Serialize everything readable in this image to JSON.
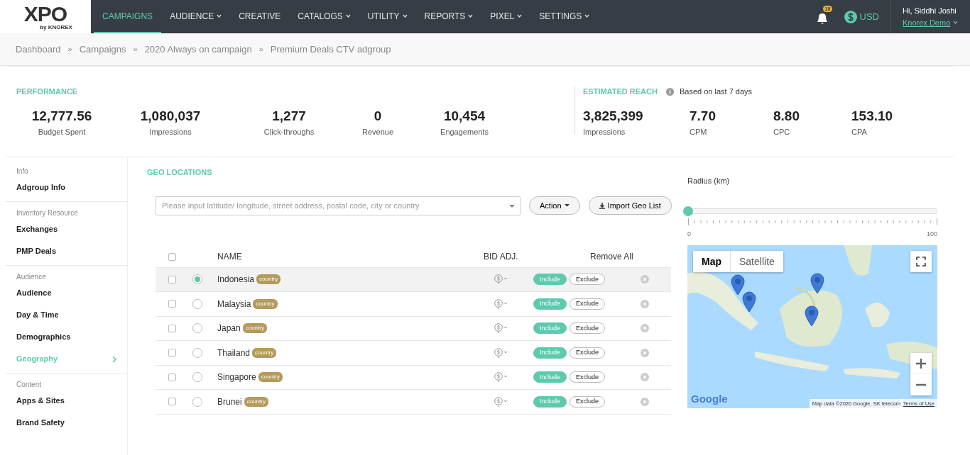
{
  "navbar": {
    "logo": "XPO",
    "logo_sub": "by KNOREX",
    "items": [
      {
        "label": "CAMPAIGNS",
        "dropdown": false,
        "selected": true
      },
      {
        "label": "AUDIENCE",
        "dropdown": true,
        "selected": false
      },
      {
        "label": "CREATIVE",
        "dropdown": false,
        "selected": false
      },
      {
        "label": "CATALOGS",
        "dropdown": true,
        "selected": false
      },
      {
        "label": "UTILITY",
        "dropdown": true,
        "selected": false
      },
      {
        "label": "REPORTS",
        "dropdown": true,
        "selected": false
      },
      {
        "label": "PIXEL",
        "dropdown": true,
        "selected": false
      },
      {
        "label": "SETTINGS",
        "dropdown": true,
        "selected": false
      }
    ],
    "notifications": "10",
    "currency": "USD",
    "greeting": "Hi, Siddhi Joshi",
    "account": "Knorex Demo"
  },
  "breadcrumb": [
    {
      "label": "Dashboard"
    },
    {
      "separator": "»",
      "label": "Campaigns"
    },
    {
      "separator": "»",
      "label": "2020 Always on campaign"
    },
    {
      "separator": "»",
      "label": "Premium Deals CTV adgroup"
    }
  ],
  "performance": {
    "title": "PERFORMANCE",
    "metrics": [
      {
        "value": "12,777.56",
        "label": "Budget Spent"
      },
      {
        "value": "1,080,037",
        "label": "Impressions"
      },
      {
        "value": "1,277",
        "label": "Click-throughs"
      },
      {
        "value": "0",
        "label": "Revenue"
      },
      {
        "value": "10,454",
        "label": "Engagements"
      }
    ]
  },
  "estimated_reach": {
    "title": "ESTIMATED REACH",
    "note": "Based on last 7 days",
    "metrics": [
      {
        "value": "3,825,399",
        "label": "Impressions"
      },
      {
        "value": "7.70",
        "label": "CPM"
      },
      {
        "value": "8.80",
        "label": "CPC"
      },
      {
        "value": "153.10",
        "label": "CPA"
      }
    ]
  },
  "sidebar": {
    "sections": [
      {
        "heading": "Info",
        "items": [
          {
            "label": "Adgroup Info",
            "selected": false
          }
        ]
      },
      {
        "heading": "Inventory Resource",
        "items": [
          {
            "label": "Exchanges",
            "selected": false
          },
          {
            "label": "PMP Deals",
            "selected": false
          }
        ]
      },
      {
        "heading": "Audience",
        "items": [
          {
            "label": "Audience",
            "selected": false
          },
          {
            "label": "Day & Time",
            "selected": false
          },
          {
            "label": "Demographics",
            "selected": false
          },
          {
            "label": "Geography",
            "selected": true
          }
        ]
      },
      {
        "heading": "Content",
        "items": [
          {
            "label": "Apps & Sites",
            "selected": false
          },
          {
            "label": "Brand Safety",
            "selected": false
          }
        ]
      }
    ]
  },
  "geo": {
    "title": "GEO LOCATIONS",
    "search": {
      "placeholder": "Please input latitude/ longitude, street address, postal code, city or country"
    },
    "action_button": "Action",
    "import_button": "Import Geo List",
    "radius": {
      "label": "Radius (km)",
      "level": 0,
      "min": "0",
      "max": "100"
    },
    "table": {
      "columns": [
        "NAME",
        "BID ADJ.",
        "Remove All"
      ],
      "select_all_checked": false,
      "rows": [
        {
          "name": "Indonesia",
          "tag": "country",
          "checked": false,
          "selected": true,
          "include": true,
          "include_label": "Include",
          "exclude_label": "Exclude"
        },
        {
          "name": "Malaysia",
          "tag": "country",
          "checked": false,
          "selected": false,
          "include": true,
          "include_label": "Include",
          "exclude_label": "Exclude"
        },
        {
          "name": "Japan",
          "tag": "country",
          "checked": false,
          "selected": false,
          "include": true,
          "include_label": "Include",
          "exclude_label": "Exclude"
        },
        {
          "name": "Thailand",
          "tag": "country",
          "checked": false,
          "selected": false,
          "include": true,
          "include_label": "Include",
          "exclude_label": "Exclude"
        },
        {
          "name": "Singapore",
          "tag": "country",
          "checked": false,
          "selected": false,
          "include": true,
          "include_label": "Include",
          "exclude_label": "Exclude"
        },
        {
          "name": "Brunei",
          "tag": "country",
          "checked": false,
          "selected": false,
          "include": true,
          "include_label": "Include",
          "exclude_label": "Exclude"
        }
      ]
    },
    "map": {
      "kind": "picture",
      "tabs": [
        {
          "label": "Map",
          "selected": true
        },
        {
          "label": "Satellite",
          "selected": false
        }
      ],
      "logo": "Google",
      "attribution": "Map data ©2020 Google, SK telecom",
      "terms": "Terms of Use"
    }
  }
}
